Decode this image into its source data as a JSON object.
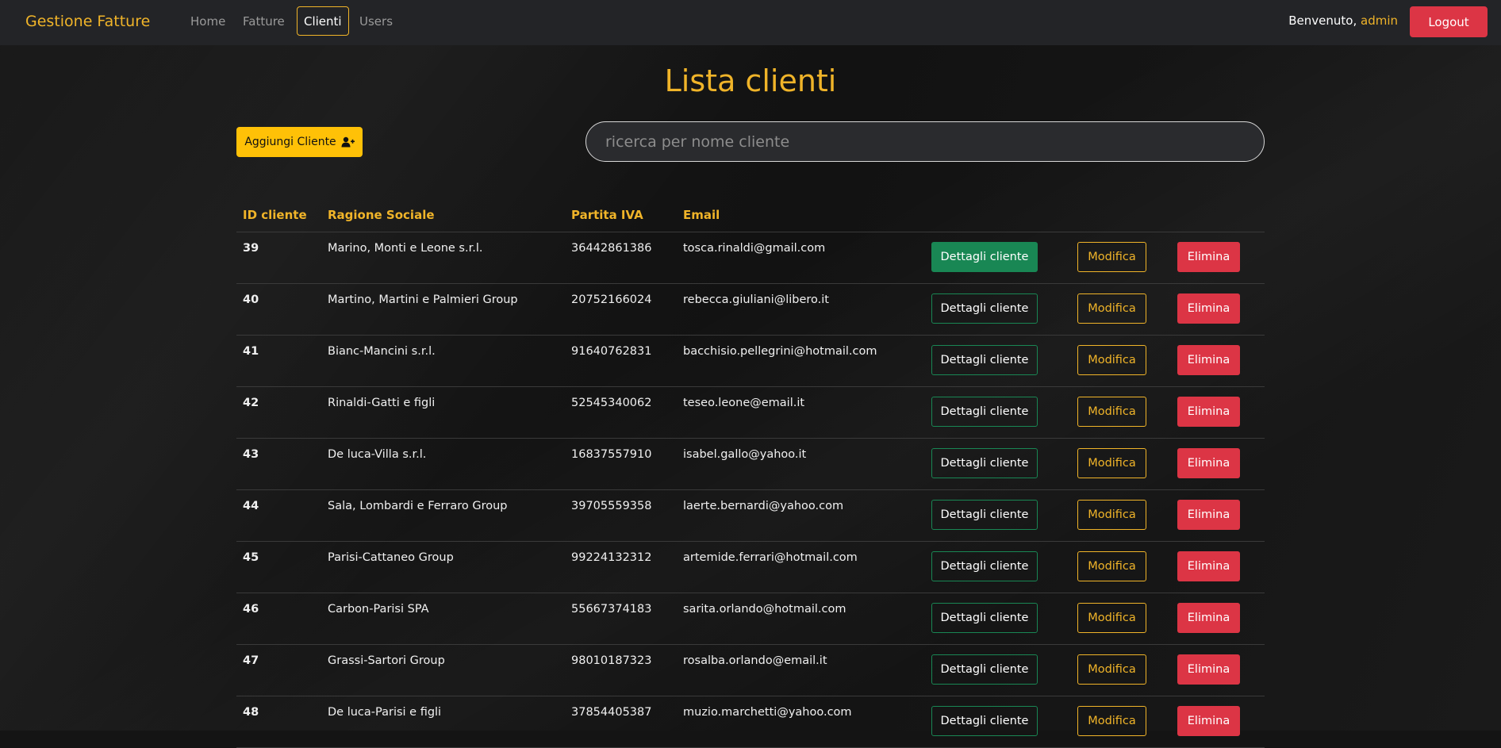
{
  "navbar": {
    "brand": "Gestione Fatture",
    "links": [
      "Home",
      "Fatture",
      "Clienti",
      "Users"
    ],
    "welcome": "Benvenuto,",
    "username": "admin",
    "logout": "Logout"
  },
  "page": {
    "title": "Lista clienti",
    "add_button": "Aggiungi Cliente",
    "search_placeholder": "ricerca per nome cliente"
  },
  "table": {
    "headers": [
      "ID cliente",
      "Ragione Sociale",
      "Partita IVA",
      "Email"
    ],
    "buttons": {
      "details": "Dettagli cliente",
      "edit": "Modifica",
      "delete": "Elimina"
    },
    "rows": [
      {
        "id": "39",
        "ragione": "Marino, Monti e Leone s.r.l.",
        "iva": "36442861386",
        "email": "tosca.rinaldi@gmail.com"
      },
      {
        "id": "40",
        "ragione": "Martino, Martini e Palmieri Group",
        "iva": "20752166024",
        "email": "rebecca.giuliani@libero.it"
      },
      {
        "id": "41",
        "ragione": "Bianc-Mancini s.r.l.",
        "iva": "91640762831",
        "email": "bacchisio.pellegrini@hotmail.com"
      },
      {
        "id": "42",
        "ragione": "Rinaldi-Gatti e figli",
        "iva": "52545340062",
        "email": "teseo.leone@email.it"
      },
      {
        "id": "43",
        "ragione": "De luca-Villa s.r.l.",
        "iva": "16837557910",
        "email": "isabel.gallo@yahoo.it"
      },
      {
        "id": "44",
        "ragione": "Sala, Lombardi e Ferraro Group",
        "iva": "39705559358",
        "email": "laerte.bernardi@yahoo.com"
      },
      {
        "id": "45",
        "ragione": "Parisi-Cattaneo Group",
        "iva": "99224132312",
        "email": "artemide.ferrari@hotmail.com"
      },
      {
        "id": "46",
        "ragione": "Carbon-Parisi SPA",
        "iva": "55667374183",
        "email": "sarita.orlando@hotmail.com"
      },
      {
        "id": "47",
        "ragione": "Grassi-Sartori Group",
        "iva": "98010187323",
        "email": "rosalba.orlando@email.it"
      },
      {
        "id": "48",
        "ragione": "De luca-Parisi e figli",
        "iva": "37854405387",
        "email": "muzio.marchetti@yahoo.com"
      }
    ]
  },
  "colors": {
    "accent": "#f0b429",
    "danger": "#dc3545",
    "success": "#198754",
    "warning": "#ffc107"
  },
  "icons": {
    "add_user": "user-plus-icon"
  }
}
